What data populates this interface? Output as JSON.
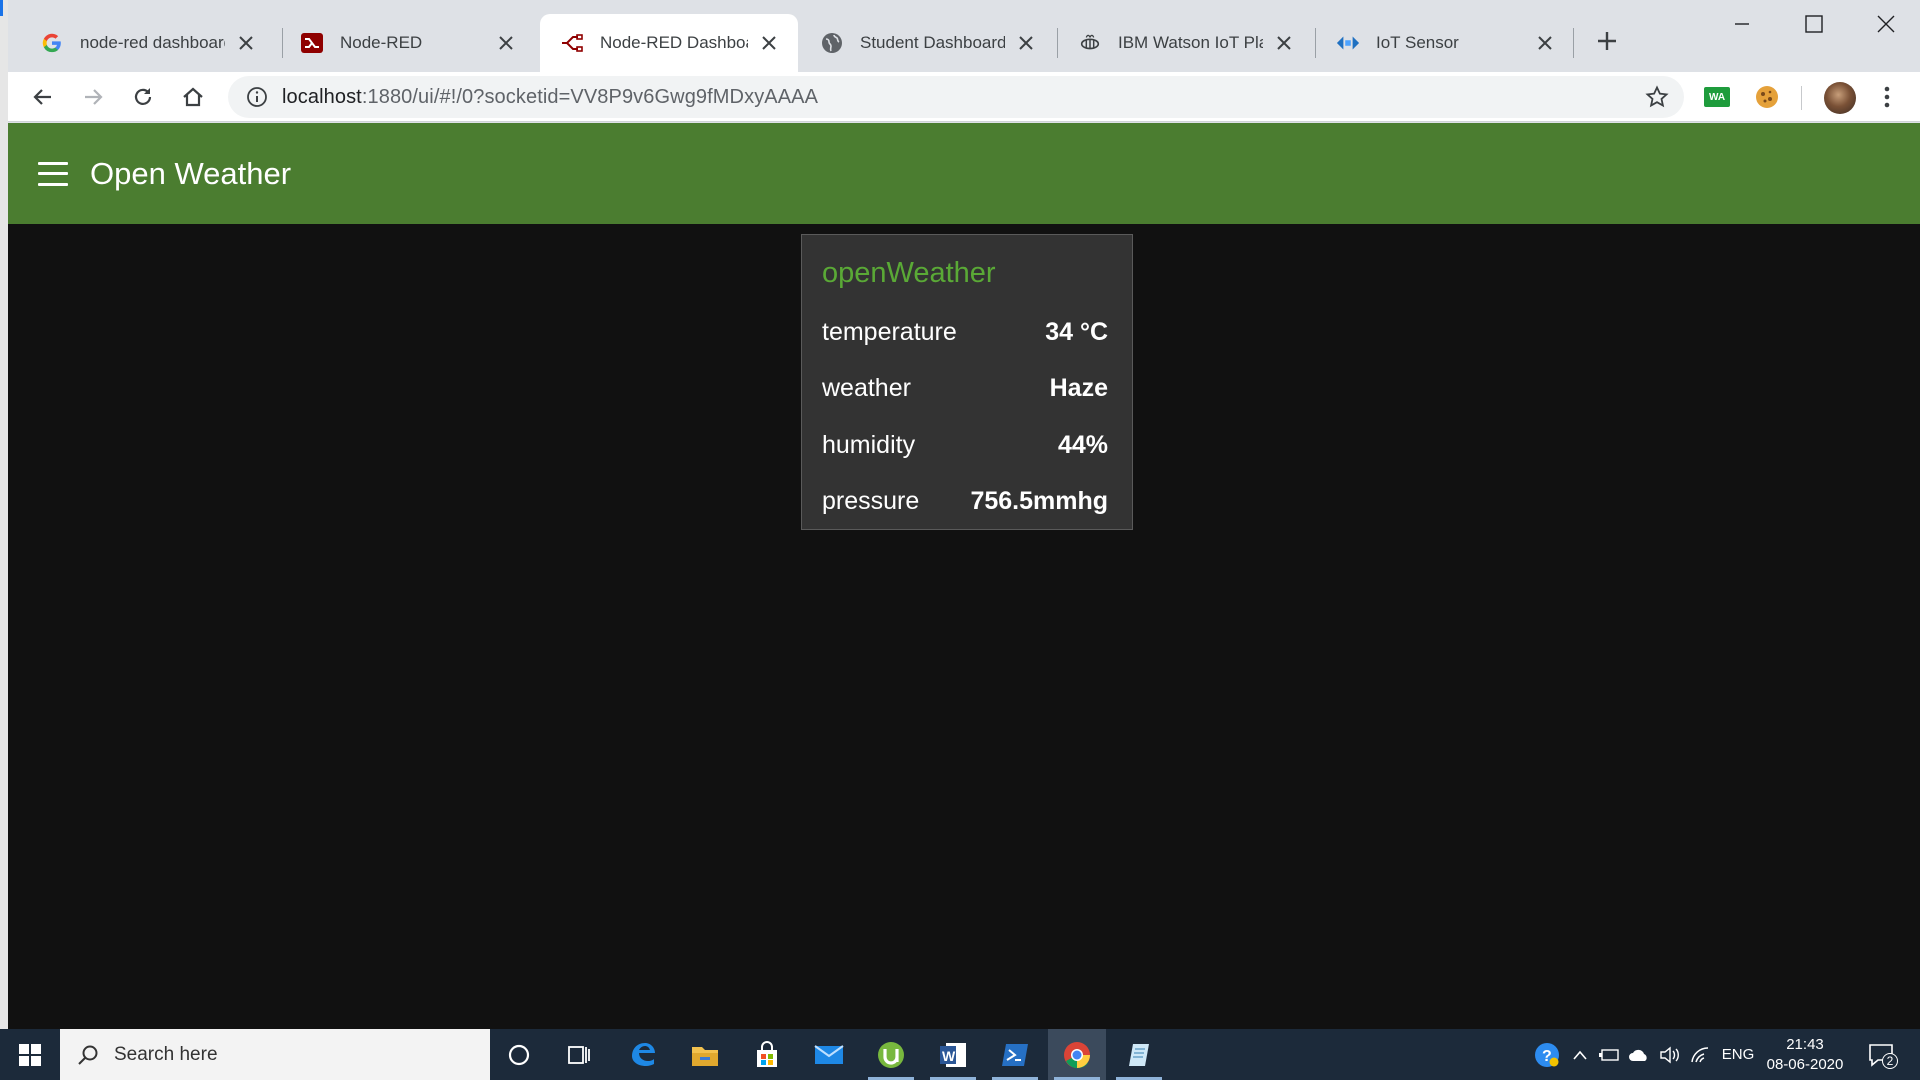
{
  "browser": {
    "tabs": [
      {
        "title": "node-red dashboard-h",
        "favicon": "google-g-icon",
        "active": false
      },
      {
        "title": "Node-RED",
        "favicon": "node-red-icon",
        "active": false
      },
      {
        "title": "Node-RED Dashboard",
        "favicon": "node-red-flow-icon",
        "active": true
      },
      {
        "title": "Student Dashboard",
        "favicon": "globe-icon",
        "active": false
      },
      {
        "title": "IBM Watson IoT Platfo",
        "favicon": "iot-bee-icon",
        "active": false
      },
      {
        "title": "IoT Sensor",
        "favicon": "iot-sensor-icon",
        "active": false
      }
    ],
    "url_host": "localhost",
    "url_path": ":1880/ui/#!/0?socketid=VV8P9v6Gwg9fMDxyAAAA",
    "extension_wa_label": "WA"
  },
  "app": {
    "title": "Open Weather",
    "header_color": "#4b7d30",
    "background_color": "#111111"
  },
  "card": {
    "title": "openWeather",
    "title_color": "#5aa936",
    "rows": [
      {
        "label": "temperature",
        "value": "34 °C"
      },
      {
        "label": "weather",
        "value": "Haze"
      },
      {
        "label": "humidity",
        "value": "44%"
      },
      {
        "label": "pressure",
        "value": "756.5mmhg"
      }
    ]
  },
  "taskbar": {
    "search_placeholder": "Search here",
    "language": "ENG",
    "time": "21:43",
    "date": "08-06-2020",
    "notification_count": "2"
  }
}
